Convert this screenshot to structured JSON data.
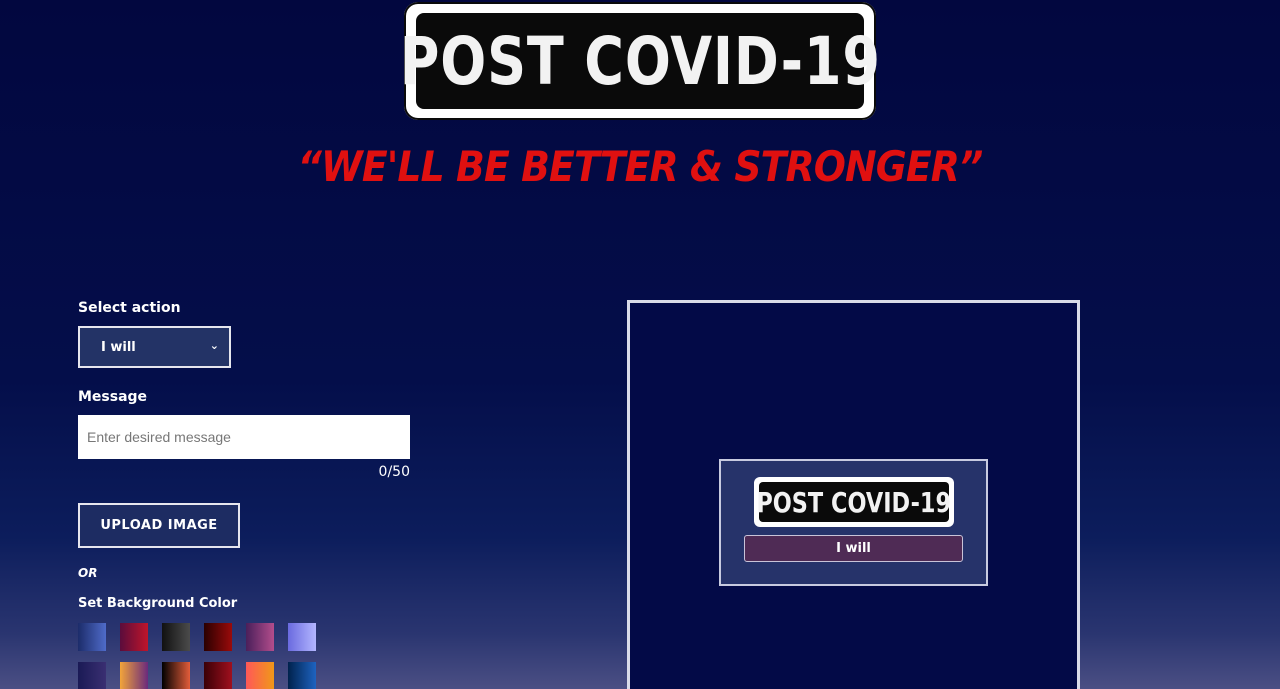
{
  "header": {
    "logo_text": "POST COVID-19",
    "tagline": "“WE'LL BE BETTER & STRONGER”"
  },
  "form": {
    "select_label": "Select action",
    "select_value": "I will",
    "message_label": "Message",
    "message_placeholder": "Enter desired message",
    "counter": "0/50",
    "upload_label": "UPLOAD IMAGE",
    "or_text": "OR",
    "bg_color_label": "Set Background Color"
  },
  "swatches": [
    {
      "name": "blue-gradient",
      "colors": [
        "#1c2c6a",
        "#4f6bc9"
      ]
    },
    {
      "name": "crimson-gradient",
      "colors": [
        "#5a0c3c",
        "#c0152a"
      ]
    },
    {
      "name": "black-gradient",
      "colors": [
        "#111111",
        "#4b4b4b"
      ]
    },
    {
      "name": "darkred-gradient",
      "colors": [
        "#2a0000",
        "#9a0b0b"
      ]
    },
    {
      "name": "purple-gradient",
      "colors": [
        "#4a1f5a",
        "#b34d8c"
      ]
    },
    {
      "name": "lavender-gradient",
      "colors": [
        "#6a6adf",
        "#b3b6ff"
      ]
    },
    {
      "name": "navy-purple-gradient",
      "colors": [
        "#1a1a55",
        "#3a2f72"
      ]
    },
    {
      "name": "orange-gradient",
      "colors": [
        "#f2a43a",
        "#6b2a7c"
      ]
    },
    {
      "name": "ember-gradient",
      "colors": [
        "#000000",
        "#e35d3a"
      ]
    },
    {
      "name": "maroon-gradient",
      "colors": [
        "#3a0006",
        "#a0101e"
      ]
    },
    {
      "name": "sunset-gradient",
      "colors": [
        "#ff5858",
        "#f09819"
      ]
    },
    {
      "name": "ocean-gradient",
      "colors": [
        "#00224d",
        "#1e63c0"
      ]
    }
  ],
  "preview": {
    "logo_text": "POST COVID-19",
    "message": "I will"
  },
  "colors": {
    "tagline": "#e01010",
    "background": "#02073f",
    "card": "#26336a",
    "pill": "#4f2b55"
  }
}
